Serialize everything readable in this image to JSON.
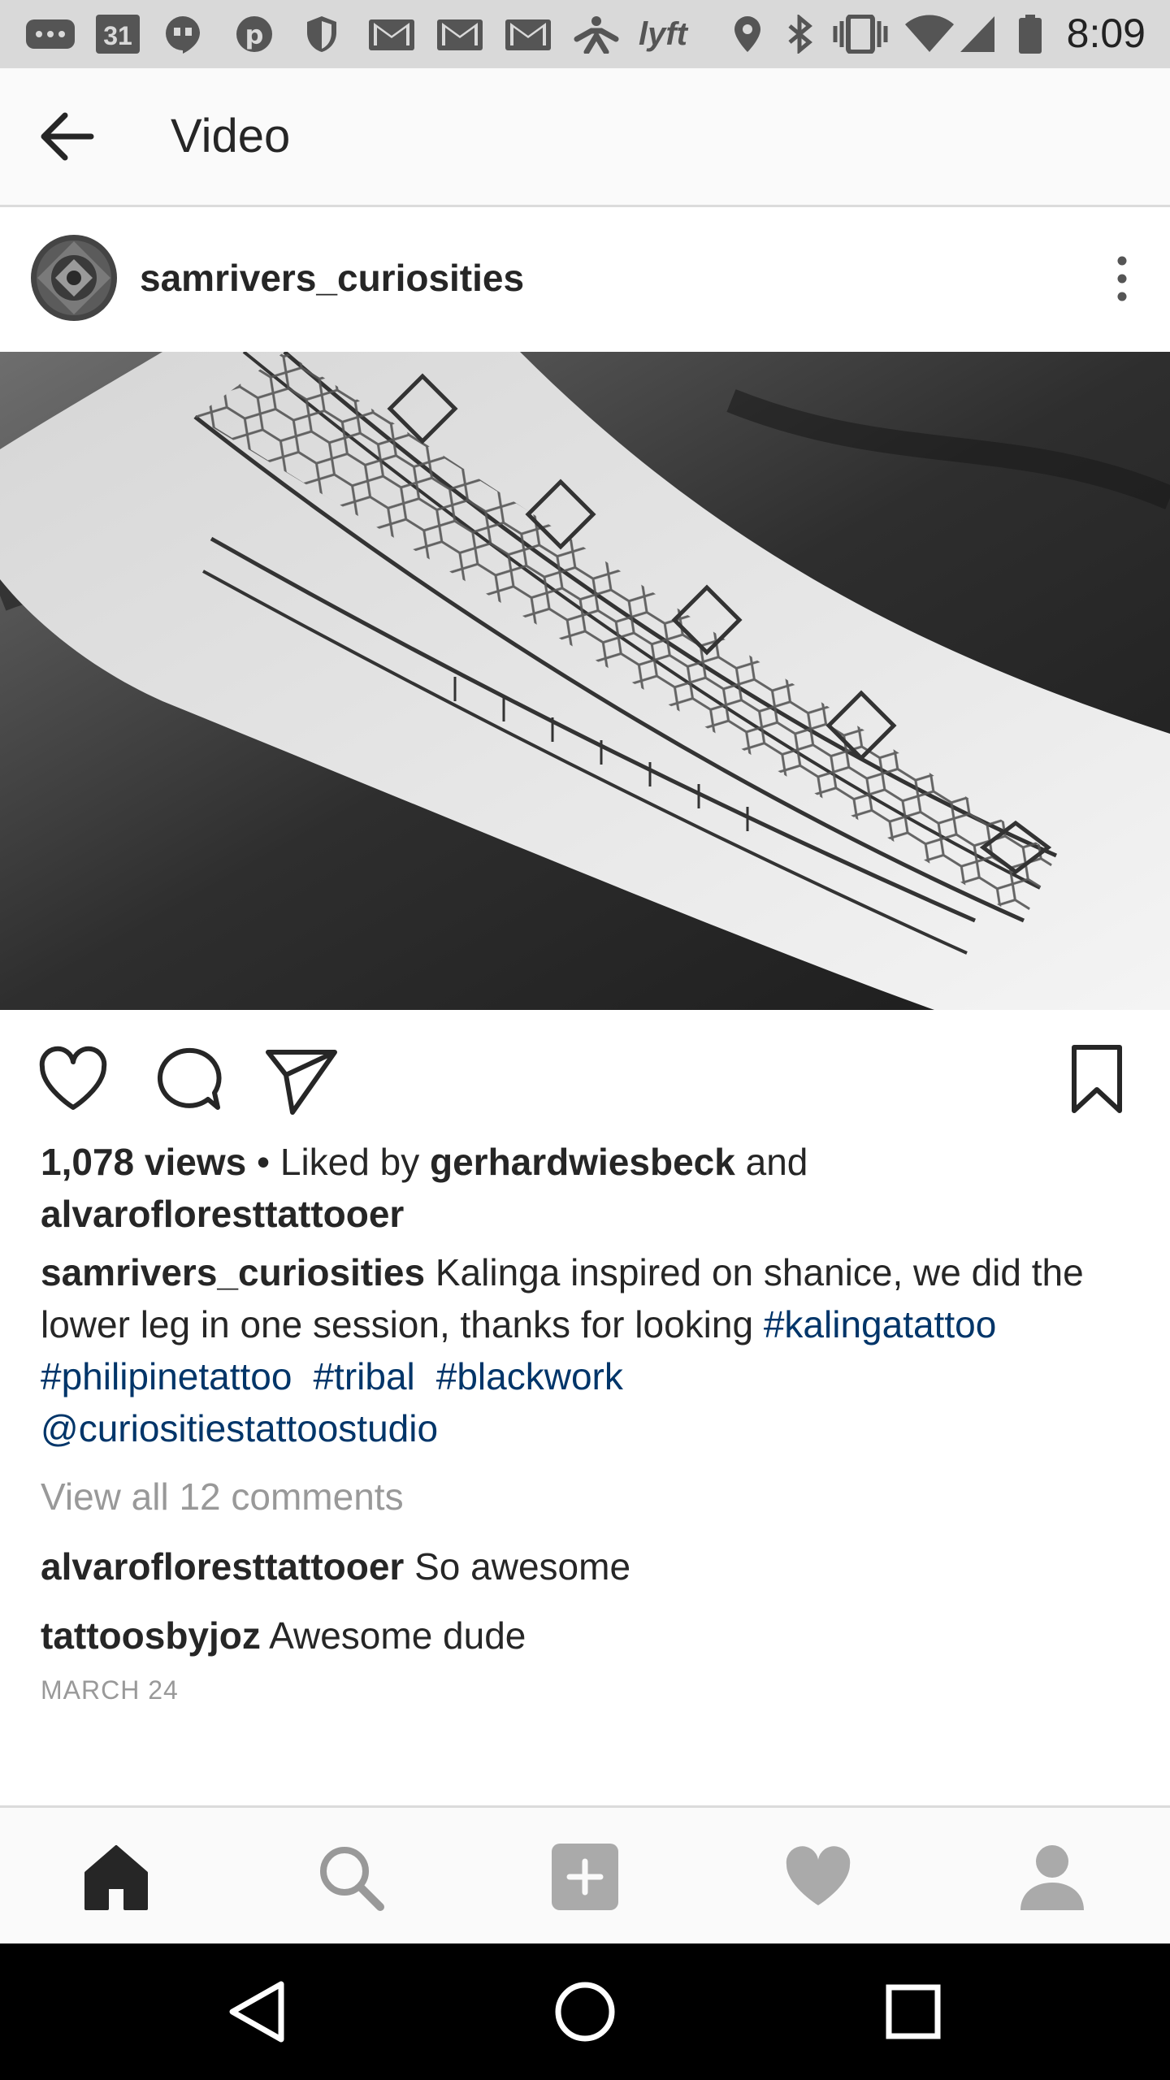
{
  "status_bar": {
    "time": "8:09",
    "calendar_day": "31",
    "icons": [
      "messages-icon",
      "calendar-icon",
      "hangouts-icon",
      "pinterest-icon",
      "shield-icon",
      "gmail-icon",
      "gmail-icon",
      "gmail-icon",
      "accessibility-icon",
      "lyft-icon",
      "location-icon",
      "bluetooth-icon",
      "vibrate-icon",
      "wifi-icon",
      "cell-signal-icon",
      "battery-icon"
    ],
    "lyft_label": "lyft"
  },
  "header": {
    "title": "Video"
  },
  "post": {
    "username": "samrivers_curiosities",
    "views": "1,078 views",
    "liked_by_prefix": " • Liked by ",
    "liker1": "gerhardwiesbeck",
    "and": " and",
    "liker2": "alvarofloresttattooer",
    "caption": {
      "author": "samrivers_curiosities",
      "text1": " Kalinga inspired on shanice, we did the",
      "text2": "lower leg in one session, thanks for looking ",
      "tag_kalinga": "#kalingatattoo",
      "tag_philipine": "#philipinetattoo",
      "tag_tribal": "#tribal",
      "tag_blackwork": "#blackwork",
      "mention": "@curiositiestattoostudio"
    },
    "view_all_comments": "View all 12 comments",
    "comments": [
      {
        "user": "alvarofloresttattooer",
        "text": " So awesome"
      },
      {
        "user": "tattoosbyjoz",
        "text": " Awesome dude"
      }
    ],
    "date": "MARCH 24"
  },
  "bottom_nav": [
    "home-icon",
    "search-icon",
    "add-post-icon",
    "activity-heart-icon",
    "profile-icon"
  ],
  "system_nav": [
    "back-triangle-icon",
    "home-circle-icon",
    "recents-square-icon"
  ],
  "colors": {
    "link": "#003569",
    "muted": "#999999",
    "text": "#262626"
  }
}
